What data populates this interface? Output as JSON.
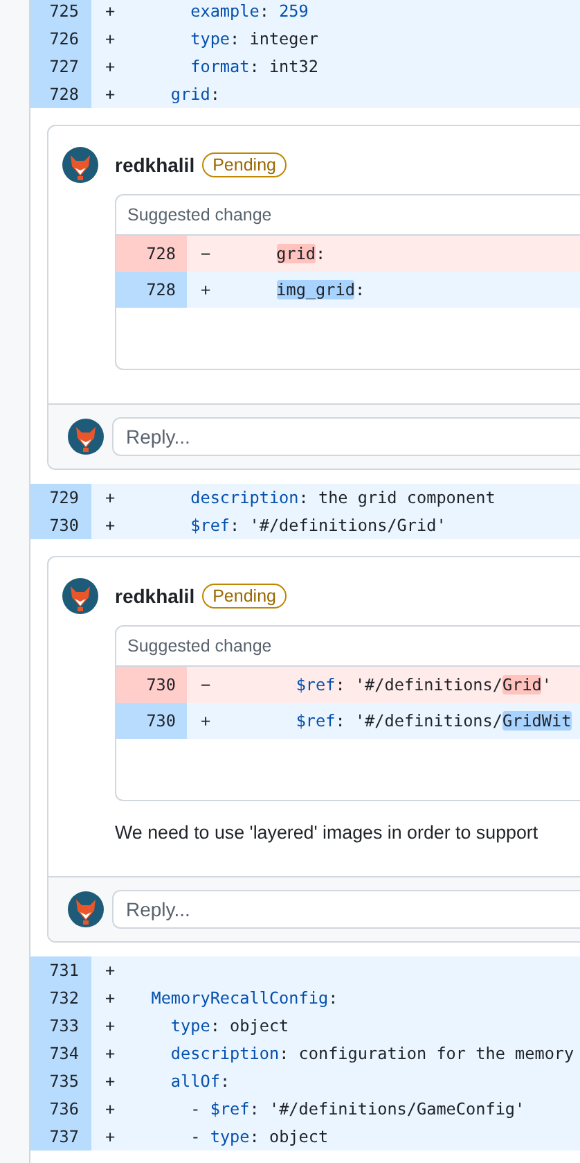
{
  "sections": [
    {
      "kind": "code",
      "lines": [
        {
          "number": "725",
          "sign": "+",
          "kind": "add",
          "tokens": [
            {
              "text": "      example",
              "kind": "key"
            },
            {
              "text": ": ",
              "kind": "plain"
            },
            {
              "text": "259",
              "kind": "number"
            }
          ]
        },
        {
          "number": "726",
          "sign": "+",
          "kind": "add",
          "tokens": [
            {
              "text": "      type",
              "kind": "key"
            },
            {
              "text": ": integer",
              "kind": "plain"
            }
          ]
        },
        {
          "number": "727",
          "sign": "+",
          "kind": "add",
          "tokens": [
            {
              "text": "      format",
              "kind": "key"
            },
            {
              "text": ": int32",
              "kind": "plain"
            }
          ]
        },
        {
          "number": "728",
          "sign": "+",
          "kind": "add",
          "tokens": [
            {
              "text": "    grid",
              "kind": "key"
            },
            {
              "text": ":",
              "kind": "plain"
            }
          ]
        }
      ]
    },
    {
      "kind": "comment",
      "author": "redkhalil",
      "badge": "Pending",
      "suggestion": {
        "title": "Suggested change",
        "lines": [
          {
            "number": "728",
            "sign": "−",
            "kind": "del",
            "tokens": [
              {
                "text": "      grid",
                "kind": "hl"
              },
              {
                "text": ":",
                "kind": "plain"
              }
            ]
          },
          {
            "number": "728",
            "sign": "+",
            "kind": "add",
            "tokens": [
              {
                "text": "      img_grid",
                "kind": "hl"
              },
              {
                "text": ":",
                "kind": "plain"
              }
            ]
          }
        ]
      },
      "reply": {
        "placeholder": "Reply..."
      }
    },
    {
      "kind": "code",
      "lines": [
        {
          "number": "729",
          "sign": "+",
          "kind": "add",
          "tokens": [
            {
              "text": "      description",
              "kind": "key"
            },
            {
              "text": ": the grid component",
              "kind": "plain"
            }
          ]
        },
        {
          "number": "730",
          "sign": "+",
          "kind": "add",
          "tokens": [
            {
              "text": "      $ref",
              "kind": "key"
            },
            {
              "text": ": '#/definitions/Grid'",
              "kind": "plain"
            }
          ]
        }
      ]
    },
    {
      "kind": "comment",
      "author": "redkhalil",
      "badge": "Pending",
      "suggestion": {
        "title": "Suggested change",
        "lines": [
          {
            "number": "730",
            "sign": "−",
            "kind": "del",
            "tokens": [
              {
                "text": "        $ref",
                "kind": "key"
              },
              {
                "text": ": '#/definitions/",
                "kind": "plain"
              },
              {
                "text": "Grid",
                "kind": "hl"
              },
              {
                "text": "'",
                "kind": "plain"
              }
            ]
          },
          {
            "number": "730",
            "sign": "+",
            "kind": "add",
            "tokens": [
              {
                "text": "        $ref",
                "kind": "key"
              },
              {
                "text": ": '#/definitions/",
                "kind": "plain"
              },
              {
                "text": "GridWit",
                "kind": "hl"
              }
            ]
          }
        ]
      },
      "body": "We need to use 'layered' images in order to support",
      "reply": {
        "placeholder": "Reply..."
      }
    },
    {
      "kind": "code",
      "lines": [
        {
          "number": "731",
          "sign": "+",
          "kind": "add"
        },
        {
          "number": "732",
          "sign": "+",
          "kind": "add",
          "tokens": [
            {
              "text": "  MemoryRecallConfig",
              "kind": "key"
            },
            {
              "text": ":",
              "kind": "plain"
            }
          ]
        },
        {
          "number": "733",
          "sign": "+",
          "kind": "add",
          "tokens": [
            {
              "text": "    type",
              "kind": "key"
            },
            {
              "text": ": object",
              "kind": "plain"
            }
          ]
        },
        {
          "number": "734",
          "sign": "+",
          "kind": "add",
          "tokens": [
            {
              "text": "    description",
              "kind": "key"
            },
            {
              "text": ": configuration for the memory",
              "kind": "plain"
            }
          ]
        },
        {
          "number": "735",
          "sign": "+",
          "kind": "add",
          "tokens": [
            {
              "text": "    allOf",
              "kind": "key"
            },
            {
              "text": ":",
              "kind": "plain"
            }
          ]
        },
        {
          "number": "736",
          "sign": "+",
          "kind": "add",
          "tokens": [
            {
              "text": "      - ",
              "kind": "plain"
            },
            {
              "text": "$ref",
              "kind": "key"
            },
            {
              "text": ": '#/definitions/GameConfig'",
              "kind": "plain"
            }
          ]
        },
        {
          "number": "737",
          "sign": "+",
          "kind": "add",
          "tokens": [
            {
              "text": "      - ",
              "kind": "plain"
            },
            {
              "text": "type",
              "kind": "key"
            },
            {
              "text": ": object",
              "kind": "plain"
            }
          ]
        }
      ]
    }
  ]
}
